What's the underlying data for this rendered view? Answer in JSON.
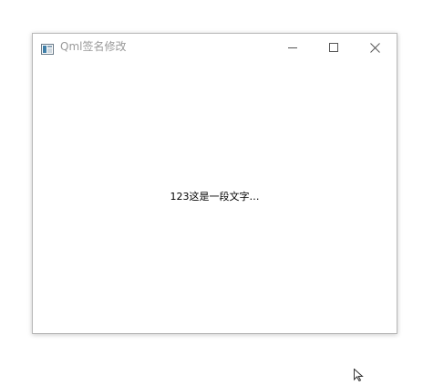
{
  "window": {
    "title": "Qml签名修改",
    "app_icon": "qt-window-icon",
    "controls": {
      "minimize_icon": "minimize-icon",
      "maximize_icon": "maximize-icon",
      "close_icon": "close-icon"
    }
  },
  "content": {
    "text": "123这是一段文字…"
  },
  "colors": {
    "title_text": "#9a9a9a",
    "content_text": "#000000",
    "window_border": "#b8b8b8",
    "background": "#ffffff"
  }
}
